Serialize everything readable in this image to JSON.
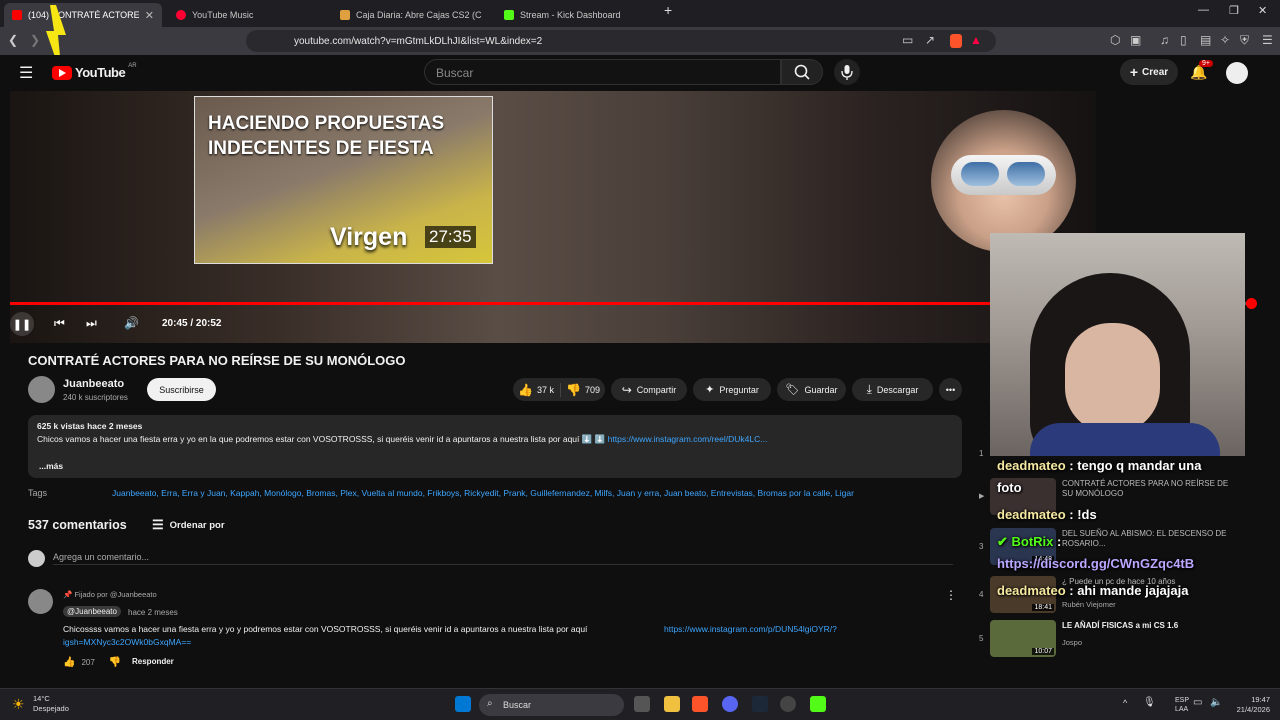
{
  "browser": {
    "tabs": [
      {
        "label": "(104) CONTRATÉ ACTORES PA",
        "active": true,
        "favicon_color": "#ff0000"
      },
      {
        "label": "YouTube Music",
        "active": false,
        "favicon_color": "#ff0033"
      },
      {
        "label": "Caja Diaria: Abre Cajas CS2 (CS:GO)",
        "active": false,
        "favicon_color": "#e0a040"
      },
      {
        "label": "Stream - Kick Dashboard",
        "active": false,
        "favicon_color": "#53fc18"
      }
    ],
    "url": "youtube.com/watch?v=mGtmLkDLhJI&list=WL&index=2"
  },
  "header": {
    "logo": "YouTube",
    "region": "AR",
    "search_placeholder": "Buscar",
    "create_label": "Crear",
    "notif_badge": "9+"
  },
  "player": {
    "endcard": {
      "title": "HACIENDO PROPUESTAS INDECENTES DE FIESTA",
      "overlay_word": "Virgen",
      "duration": "27:35"
    },
    "time": "20:45 / 20:52",
    "progress_fraction": 0.993
  },
  "video": {
    "title": "CONTRATÉ ACTORES PARA NO REÍRSE DE SU MONÓLOGO",
    "channel": "Juanbeeato",
    "subscribers": "240 k suscriptores",
    "subscribe_label": "Suscribirse",
    "likes": "37 k",
    "dislikes": "709",
    "share_label": "Compartir",
    "ask_label": "Preguntar",
    "save_label": "Guardar",
    "download_label": "Descargar"
  },
  "description": {
    "meta": "625 k vistas  hace 2 meses",
    "text": "Chicos vamos a hacer una fiesta erra y yo en la que podremos estar con VOSOTROSSS, si queréis venir id a apuntaros a nuestra lista por aquí ⬇️ ⬇️",
    "link": "https://www.instagram.com/reel/DUk4LC...",
    "more": "...más"
  },
  "tags": {
    "label": "Tags",
    "items": "Juanbeeato, Erra, Erra y Juan, Kappah, Monólogo, Bromas, Plex, Vuelta al mundo, Frikboys, Rickyedit, Prank, Guillefernandez, Milfs, Juan y erra, Juan beato, Entrevistas, Bromas por la calle, Ligar"
  },
  "comments": {
    "count": "537 comentarios",
    "sort_label": "Ordenar por",
    "add_placeholder": "Agrega un comentario...",
    "pinned": {
      "pinned_label": "Fijado por @Juanbeeato",
      "author": "@Juanbeeato",
      "time": "hace 2 meses",
      "text": "Chicossss vamos a hacer una fiesta erra y yo y podremos estar con VOSOTROSSS, si queréis venir id a apuntaros a nuestra lista por aquí",
      "link": "https://www.instagram.com/p/DUN54lgiOYR/?",
      "link2": "igsh=MXNyc3c2OWk0bGxqMA==",
      "likes": "207",
      "reply_label": "Responder"
    }
  },
  "playlist": [
    {
      "index": "1",
      "title": "",
      "channel": "",
      "duration": ""
    },
    {
      "index": "▶",
      "title": "CONTRATÉ ACTORES PARA NO REÍRSE DE SU MONÓLOGO",
      "channel": "",
      "duration": ""
    },
    {
      "index": "3",
      "title": "DEL SUEÑO AL ABISMO: EL DESCENSO DE ROSARIO...",
      "channel": "",
      "duration": "14:48"
    },
    {
      "index": "4",
      "title": "¿ Puede un pc de hace 10 años",
      "channel": "Rubén Viejomer",
      "duration": "18:41"
    },
    {
      "index": "5",
      "title": "LE AÑADÍ FISICAS a mi CS 1.6",
      "channel": "Jospo",
      "duration": "10:07"
    }
  ],
  "chat": [
    {
      "user": "deadmateo",
      "message": " : tengo q mandar una"
    },
    {
      "user": "",
      "message": "foto"
    },
    {
      "user": "deadmateo",
      "message": " : !ds"
    },
    {
      "user": "BotRix",
      "message": " :"
    },
    {
      "user": "",
      "message": "https://discord.gg/CWnGZqc4tB"
    },
    {
      "user": "deadmateo",
      "message": " : ahi mande jajajaja"
    }
  ],
  "taskbar": {
    "weather_temp": "14°C",
    "weather_desc": "Despejado",
    "search_label": "Buscar",
    "lang": "ESP",
    "lang2": "LAA",
    "time": "19:47",
    "date": "21/4/2026"
  }
}
